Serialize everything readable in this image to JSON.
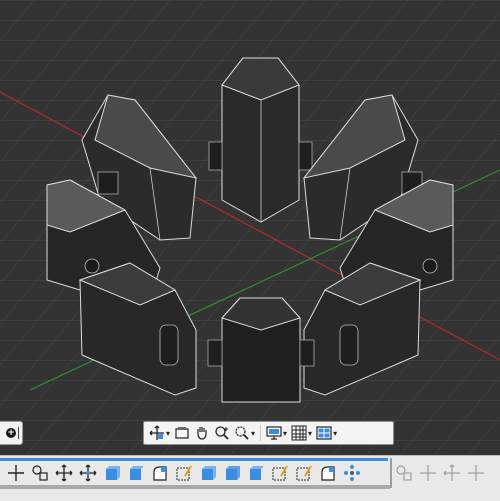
{
  "viewport": {
    "grid_color": "#4a4a4a",
    "axis_x_color": "#b52a2a",
    "axis_y_color": "#2f8f2f",
    "model_color": "#2b2b2b",
    "edge_color": "#d8d8d8"
  },
  "nav_toolbar": {
    "tools": [
      {
        "icon": "pan-orbit-icon",
        "dropdown": true
      },
      {
        "icon": "viewcube-icon",
        "dropdown": false
      },
      {
        "icon": "hand-pan-icon",
        "dropdown": false
      },
      {
        "icon": "zoom-icon",
        "dropdown": false
      },
      {
        "icon": "zoom-window-icon",
        "dropdown": true
      },
      {
        "icon": "display-settings-icon",
        "dropdown": true
      },
      {
        "icon": "grid-icon",
        "dropdown": true
      },
      {
        "icon": "viewports-icon",
        "dropdown": true
      }
    ]
  },
  "ribbon": {
    "accent_color": "#3b8de0",
    "tools": [
      "move-icon",
      "pan-icon",
      "move-arrows-icon",
      "orbit-icon",
      "box-icon",
      "box-edit-icon",
      "extrude-icon",
      "sketch-icon",
      "cube-icon",
      "cube-edit-icon",
      "box-select-icon",
      "box-select-2-icon",
      "sketch-2-icon",
      "fillet-icon",
      "pattern-icon"
    ],
    "disabled_tools": [
      "combine-icon",
      "align-icon",
      "mirror-icon",
      "move-4-icon"
    ]
  }
}
